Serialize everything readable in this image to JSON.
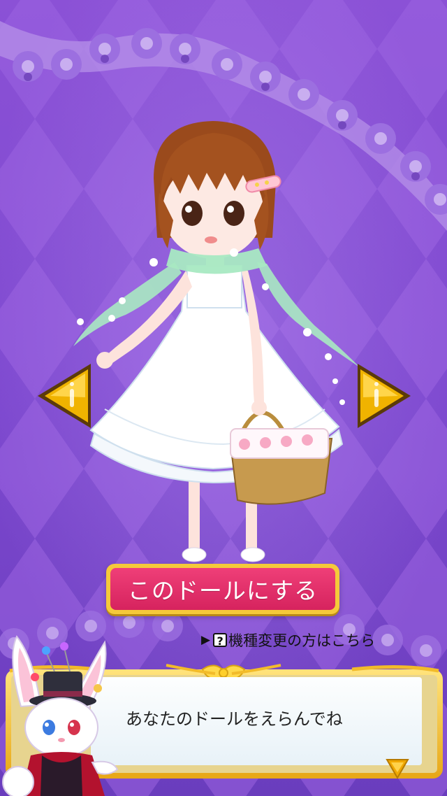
{
  "screen": {
    "select_button_label": "このドールにする",
    "device_change_link": "機種変更の方はこちら",
    "device_change_arrow": "▶",
    "device_change_icon": "?",
    "dialog_message": "あなたのドールをえらんでね"
  },
  "icons": {
    "prev": "arrow-left-icon",
    "next": "arrow-right-icon",
    "dialog_next": "triangle-down-icon",
    "help": "question-box-icon"
  },
  "colors": {
    "background_purple": "#7a45c8",
    "button_pink": "#e33068",
    "button_border": "#f5c93a",
    "arrow_gold": "#f0b300",
    "scarf_green": "#a8e9c2"
  }
}
